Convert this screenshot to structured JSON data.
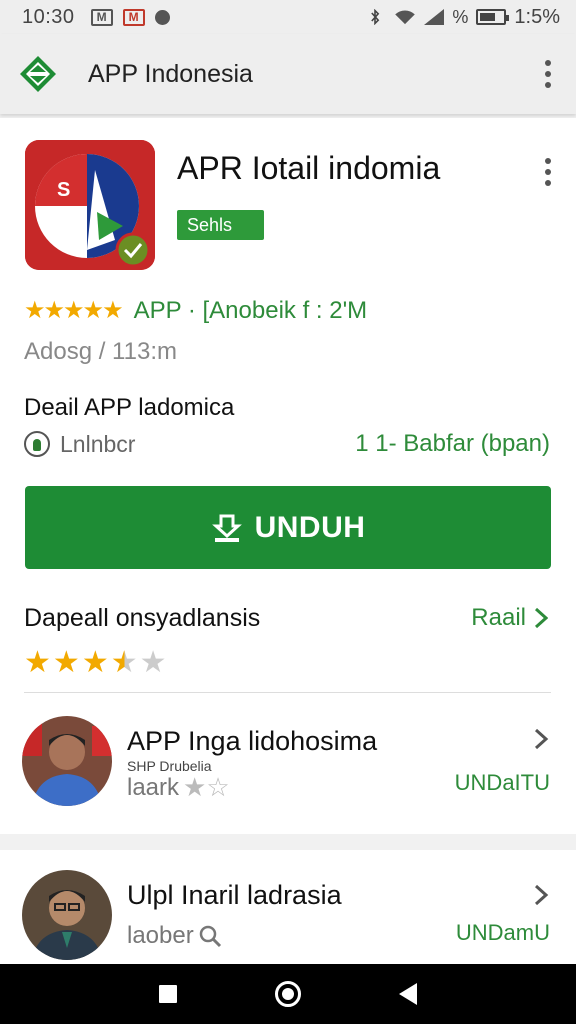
{
  "status_bar": {
    "time": "10:30",
    "notif_1": "M",
    "notif_2": "M",
    "battery_text": "%",
    "battery_percent": "1:5%",
    "battery_level": 0.55
  },
  "app_bar": {
    "title": "APP Indonesia",
    "logo_color": "#1e8c35"
  },
  "app": {
    "name": "APR Iotail indomia",
    "badge": "Sehls",
    "stars": "★★★★★",
    "rating_text": "APP · [Anobeik  f : 2'M",
    "downloads": "Adosg / 113:m",
    "detail_title": "Deail APP ladomica",
    "detail_label": "Lnlnbcr",
    "detail_size": "1 1- Babfar (bpan)",
    "install_label": "UNDUH",
    "accent": "#1e8c35",
    "icon_bg": "#c62828"
  },
  "reviews": {
    "title": "Dapeall onsyadlansis",
    "link": "Raail",
    "rating": 3.5,
    "star_color": "#f2a900",
    "star_empty_color": "#cccccc"
  },
  "related": [
    {
      "title": "APP Inga lidohosima",
      "subtitle": "SHP Drubelia",
      "meta": "laark",
      "meta_icon": "star-icon",
      "action": "UNDaITU"
    },
    {
      "title": "Ulpl Inaril ladrasia",
      "meta": "laober",
      "meta_icon": "search-icon",
      "action": "UNDamU"
    }
  ],
  "nav": {
    "buttons": [
      "recents-icon",
      "home-icon",
      "back-icon"
    ]
  }
}
